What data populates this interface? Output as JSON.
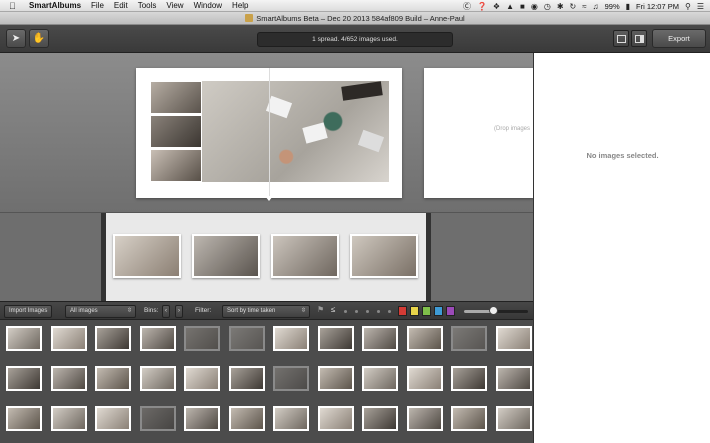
{
  "menubar": {
    "app_name": "SmartAlbums",
    "items": [
      "File",
      "Edit",
      "Tools",
      "View",
      "Window",
      "Help"
    ],
    "battery": "99%",
    "clock": "Fri 12:07 PM"
  },
  "window": {
    "title": "SmartAlbums Beta – Dec 20 2013 584af809 Build – Anne-Paul"
  },
  "toolbar": {
    "status": "1 spread. 4/652 images used.",
    "export_label": "Export"
  },
  "canvas": {
    "drop_hint": "(Drop images"
  },
  "right_panel": {
    "empty_text": "No images selected."
  },
  "bin_toolbar": {
    "import_label": "Import Images",
    "bin_select": "All images",
    "bins_label": "Bins:",
    "filter_label": "Filter:",
    "sort_select": "Sort by time taken",
    "color_labels": [
      "#d33b35",
      "#e8d44a",
      "#7fbf4a",
      "#3e9bd6",
      "#9b4ab8"
    ],
    "thumb_size_fraction": 0.45
  },
  "spread_strip": {
    "thumb_count": 4
  },
  "image_bin": {
    "thumb_count": 36
  }
}
